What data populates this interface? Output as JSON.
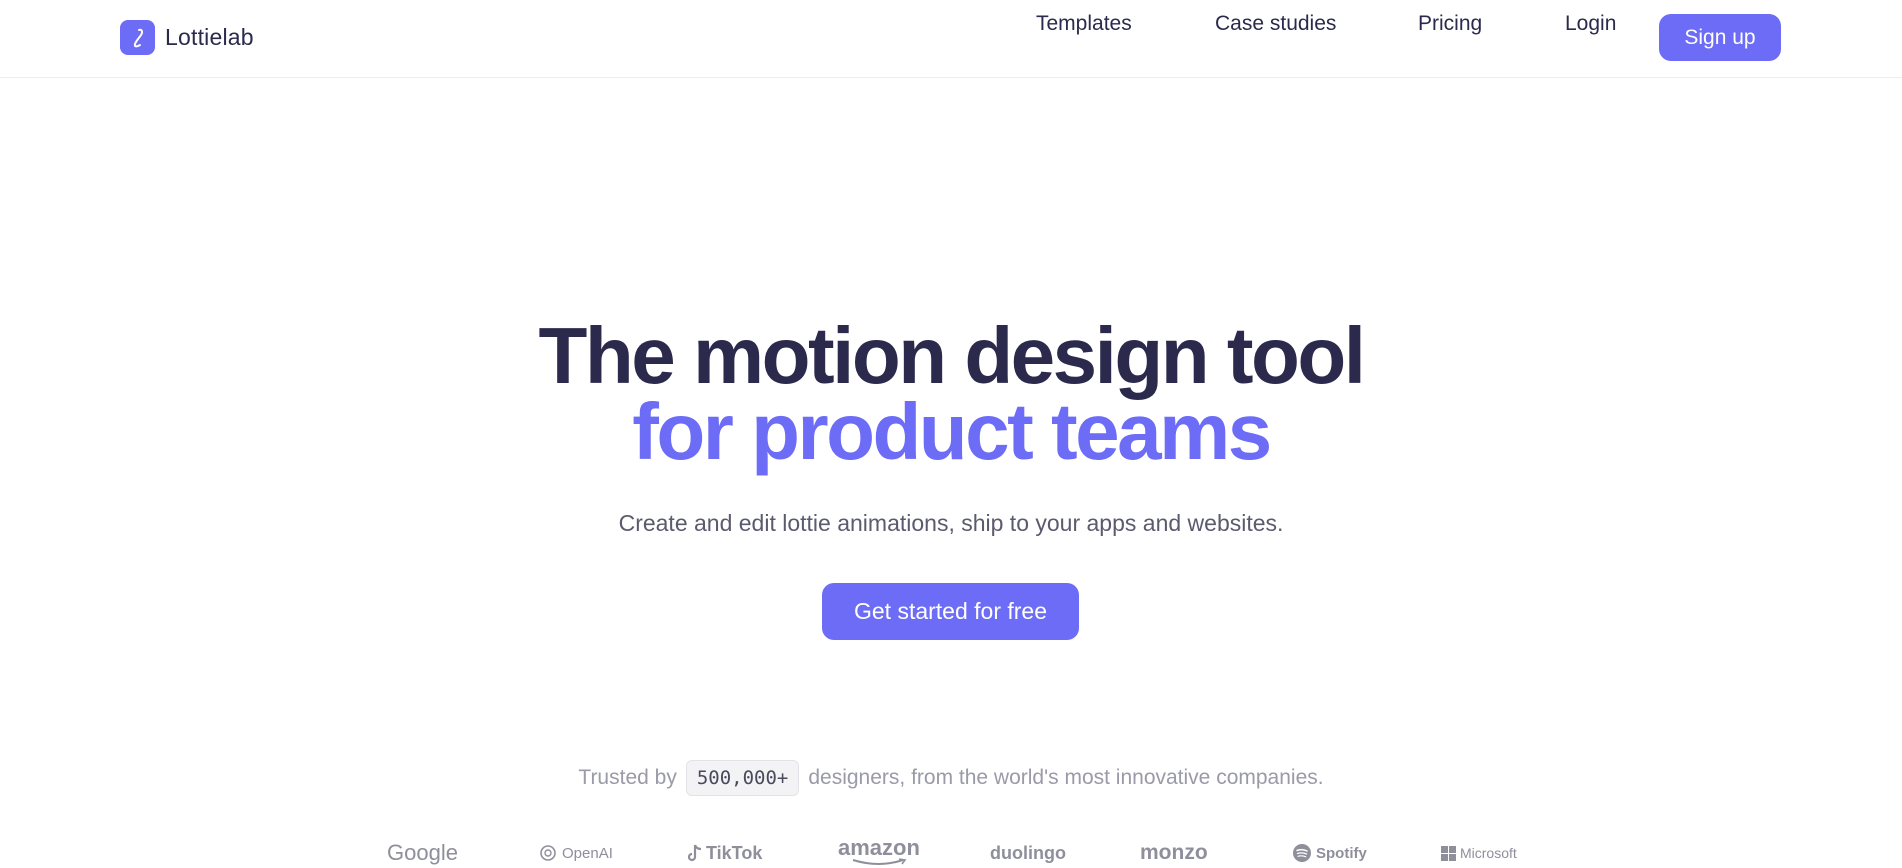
{
  "nav": {
    "brand": {
      "logo_letter": "ℓ",
      "name": "Lottielab",
      "icon": "lottielab-logo-icon"
    },
    "links": [
      "Templates",
      "Case studies",
      "Pricing",
      "Login"
    ],
    "signup_label": "Sign up"
  },
  "hero": {
    "title_line1": "The motion design tool",
    "title_line2": "for product teams",
    "subtitle": "Create and edit lottie animations, ship to your apps and websites.",
    "cta_label": "Get started for free"
  },
  "trusted": {
    "prefix": "Trusted by",
    "count": "500,000+",
    "suffix": "designers, from the world's most innovative companies."
  },
  "logos": [
    "Google",
    "OpenAI",
    "TikTok",
    "amazon",
    "duolingo",
    "monzo",
    "Spotify",
    "Microsoft"
  ],
  "colors": {
    "accent": "#6c6cf6",
    "heading": "#2b2a4c",
    "muted": "#9a9aa8"
  }
}
